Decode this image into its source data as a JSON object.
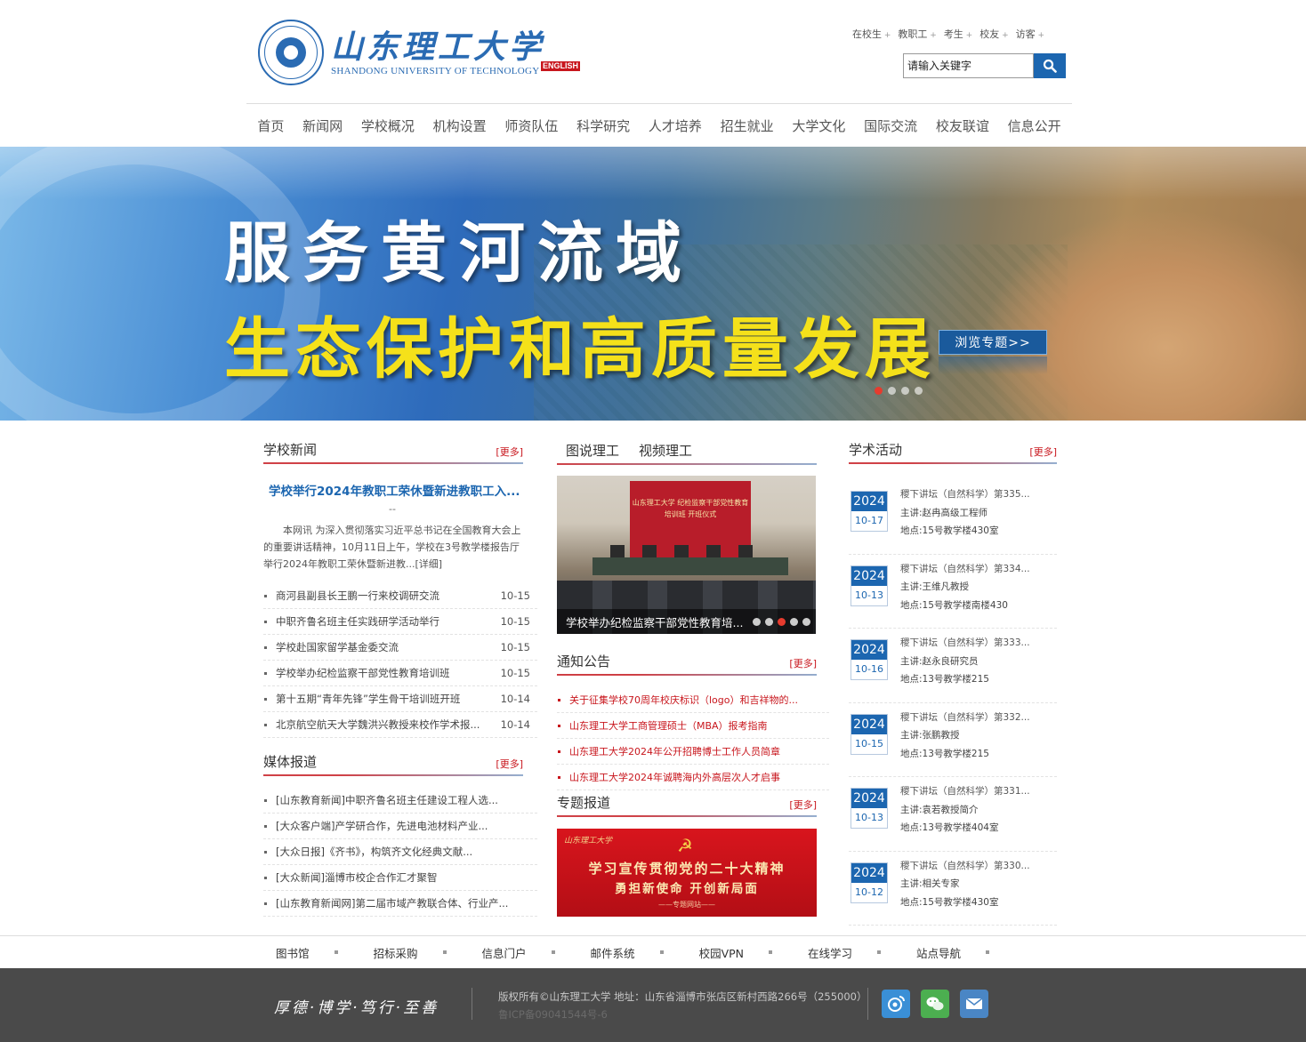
{
  "header": {
    "logo_cn": "山东理工大学",
    "logo_en": "SHANDONG UNIVERSITY OF TECHNOLOGY",
    "english_label": "ENGLISH",
    "top_links": [
      "在校生",
      "教职工",
      "考生",
      "校友",
      "访客"
    ],
    "search_placeholder": "请输入关键字"
  },
  "nav": [
    "首页",
    "新闻网",
    "学校概况",
    "机构设置",
    "师资队伍",
    "科学研究",
    "人才培养",
    "招生就业",
    "大学文化",
    "国际交流",
    "校友联谊",
    "信息公开"
  ],
  "banner": {
    "line1": "服务黄河流域",
    "line2": "生态保护和高质量发展",
    "button": "浏览专题>>",
    "slide_count": 4,
    "active_slide": 1
  },
  "school_news": {
    "title": "学校新闻",
    "more": "[更多]",
    "headline": "学校举行2024年教职工荣休暨新进教职工入...",
    "dash": "--",
    "summary": "本网讯 为深入贯彻落实习近平总书记在全国教育大会上的重要讲话精神，10月11日上午，学校在3号教学楼报告厅举行2024年教职工荣休暨新进教...[详细]",
    "items": [
      {
        "title": "商河县副县长王鹏一行来校调研交流",
        "date": "10-15"
      },
      {
        "title": "中职齐鲁名班主任实践研学活动举行",
        "date": "10-15"
      },
      {
        "title": "学校赴国家留学基金委交流",
        "date": "10-15"
      },
      {
        "title": "学校举办纪检监察干部党性教育培训班",
        "date": "10-15"
      },
      {
        "title": "第十五期“青年先锋”学生骨干培训班开班",
        "date": "10-14"
      },
      {
        "title": "北京航空航天大学魏洪兴教授来校作学术报...",
        "date": "10-14"
      }
    ]
  },
  "media": {
    "title": "媒体报道",
    "more": "[更多]",
    "items": [
      "[山东教育新闻]中职齐鲁名班主任建设工程人选...",
      "[大众客户端]产学研合作，先进电池材料产业...",
      "[大众日报]《齐书》，构筑齐文化经典文献...",
      "[大众新闻]淄博市校企合作汇才聚智",
      "[山东教育新闻网]第二届市域产教联合体、行业产..."
    ]
  },
  "middle": {
    "tabs": [
      "图说理工",
      "视频理工"
    ],
    "photo_screen": "山东理工大学 纪检监察干部党性教育培训班 开班仪式",
    "photo_caption": "学校举办纪检监察干部党性教育培...",
    "photo_dots": 5,
    "photo_active": 3,
    "notice_title": "通知公告",
    "notice_more": "[更多]",
    "notices": [
      "关于征集学校70周年校庆标识（logo）和吉祥物的...",
      "山东理工大学工商管理硕士（MBA）报考指南",
      "山东理工大学2024年公开招聘博士工作人员简章",
      "山东理工大学2024年诚聘海内外高层次人才启事"
    ],
    "special_title": "专题报道",
    "special_more": "[更多]",
    "special_logo": "山东理工大学",
    "special_line1": "学习宣传贯彻党的二十大精神",
    "special_line2": "勇担新使命  开创新局面",
    "special_line3": "——专题网站——"
  },
  "academic": {
    "title": "学术活动",
    "more": "[更多]",
    "events": [
      {
        "year": "2024",
        "md": "10-17",
        "title": "稷下讲坛（自然科学）第335...",
        "speaker": "主讲:赵冉高级工程师",
        "place": "地点:15号教学楼430室"
      },
      {
        "year": "2024",
        "md": "10-13",
        "title": "稷下讲坛（自然科学）第334...",
        "speaker": "主讲:王维凡教授",
        "place": "地点:15号教学楼南楼430"
      },
      {
        "year": "2024",
        "md": "10-16",
        "title": "稷下讲坛（自然科学）第333...",
        "speaker": "主讲:赵永良研究员",
        "place": "地点:13号教学楼215"
      },
      {
        "year": "2024",
        "md": "10-15",
        "title": "稷下讲坛（自然科学）第332...",
        "speaker": "主讲:张鹏教授",
        "place": "地点:13号教学楼215"
      },
      {
        "year": "2024",
        "md": "10-13",
        "title": "稷下讲坛（自然科学）第331...",
        "speaker": "主讲:袁若教授简介",
        "place": "地点:13号教学楼404室"
      },
      {
        "year": "2024",
        "md": "10-12",
        "title": "稷下讲坛（自然科学）第330...",
        "speaker": "主讲:相关专家",
        "place": "地点:15号教学楼430室"
      }
    ]
  },
  "footer_links": [
    "图书馆",
    "招标采购",
    "信息门户",
    "邮件系统",
    "校园VPN",
    "在线学习",
    "站点导航"
  ],
  "footer": {
    "motto": "厚德·博学·笃行·至善",
    "copyright": "版权所有©山东理工大学    地址：山东省淄博市张店区新村西路266号（255000）",
    "icp": "鲁ICP备09041544号-6"
  },
  "colors": {
    "brand_blue": "#1c66b0",
    "brand_red": "#c8161d",
    "footer_bg": "#4a4a4a"
  }
}
